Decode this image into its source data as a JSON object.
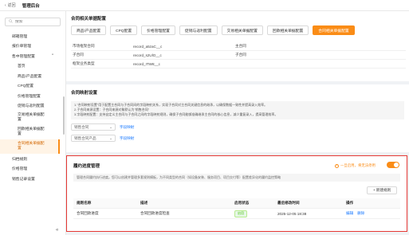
{
  "topbar": {
    "back_label": "返回",
    "title": "管理后台"
  },
  "sidebar": {
    "search_placeholder": "搜索",
    "items": [
      {
        "label": "邮箱管理"
      },
      {
        "label": "报价单管理"
      },
      {
        "label": "售中管理配置"
      },
      {
        "label": "首页"
      },
      {
        "label": "商品/产品配置"
      },
      {
        "label": "CPQ配置"
      },
      {
        "label": "价格管理配置"
      },
      {
        "label": "促销与返利配置"
      },
      {
        "label": "交易相关单据配置"
      },
      {
        "label": "回款相关单据配置"
      },
      {
        "label": "合同相关单据配置"
      },
      {
        "label": "归档规则"
      },
      {
        "label": "价格管理"
      },
      {
        "label": "销售记录设置"
      }
    ],
    "collapse_icon": "double-chevron-left-icon"
  },
  "config_card": {
    "title": "合同相关单据配置",
    "tabs": [
      "商品/产品配置",
      "CPQ配置",
      "价格管理配置",
      "促销与返利配置",
      "交易相关单据配置",
      "回款相关单据配置",
      "合同相关单据配置"
    ],
    "rows": [
      {
        "name": "市场框架合同",
        "api": "record_a5zaC__c",
        "type": "主合同"
      },
      {
        "name": "子合同",
        "api": "record_s2UlO__c",
        "type": "子合同"
      },
      {
        "name": "框架业务类型",
        "api": "record_ITW8__c",
        "type": ""
      }
    ]
  },
  "mapping_card": {
    "title": "合同映射设置",
    "notice": [
      "1.\"合同映射设置\"用于配置主合同与子合同间的字段映射关系，实现子合同对主合同关键信息的继承，以确保数据一致性并提高录入效率。",
      "2.子合同来源设置：子合同来源对象默认为\"销售合同\"",
      "3.字段映射配置：支持自定义主合同与子合同之间的字段映射规则，确保子合同能够准确继承主合同的核心信息，减少重复录入，提高管理效率。"
    ],
    "rows": [
      {
        "select_value": "销售合同",
        "link": "字段映射"
      },
      {
        "select_value": "销售合同产品",
        "link": "字段映射"
      }
    ]
  },
  "progress_card": {
    "title": "履约进度管理",
    "hint": "一旦启用，将无法停用",
    "enabled": true,
    "description": "管理合同履约执行进度。您可以创建并管理多套规则模板，为不同类型的合同（如设备安装、服务项目、项目交付等）配置差异化的履约监控策略",
    "new_button": "+ 新建规则",
    "columns": [
      "规则名称",
      "描述",
      "启用状态",
      "最后修改时间",
      "操作"
    ],
    "rows": [
      {
        "name": "合同回款进度",
        "desc": "合同回款进度检查",
        "status": "启用",
        "modified": "2025-12-05 18:38",
        "edit": "编辑",
        "delete": "删除"
      }
    ]
  },
  "colors": {
    "accent": "#fa8c16",
    "link": "#1677ff",
    "highlight_border": "#e53935",
    "success": "#52c41a"
  }
}
